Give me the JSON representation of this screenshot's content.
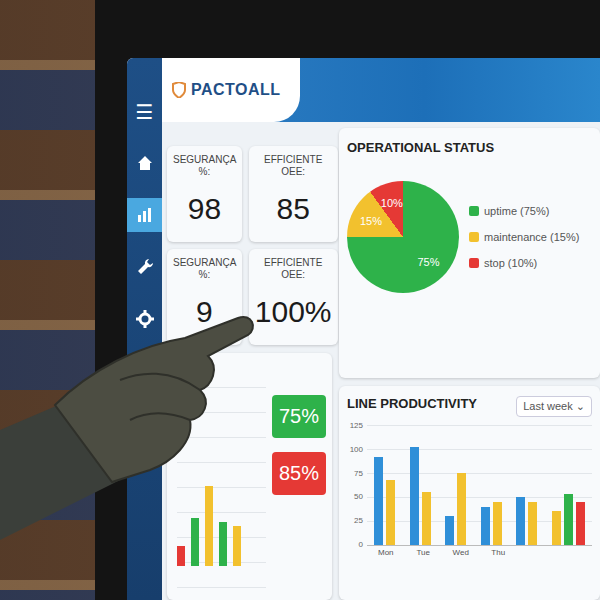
{
  "logo": {
    "text": "PACTOALL"
  },
  "menu_button": "☰",
  "sidebar": {
    "items": [
      {
        "selected": false
      },
      {
        "selected": true
      },
      {
        "selected": false
      },
      {
        "selected": false
      }
    ]
  },
  "kpis": [
    {
      "label": "SEGURANÇA %:",
      "value": "98"
    },
    {
      "label": "EFFICIENTE OEE:",
      "value": "85"
    },
    {
      "label": "SEGURANÇA %:",
      "value": "9"
    },
    {
      "label": "EFFICIENTE OEE:",
      "value": "100%"
    }
  ],
  "mini_chart": {
    "bars": [
      {
        "value": 25,
        "color": "#e53935"
      },
      {
        "value": 60,
        "color": "#2eb24a"
      },
      {
        "value": 100,
        "color": "#f2c12e"
      },
      {
        "value": 55,
        "color": "#2eb24a"
      },
      {
        "value": 50,
        "color": "#f2c12e"
      }
    ],
    "badges": [
      {
        "text": "75%",
        "color": "#2eb24a"
      },
      {
        "text": "85%",
        "color": "#e53935"
      }
    ]
  },
  "status": {
    "title": "OPERATIONAL STATUS",
    "slices": [
      {
        "label": "uptime (75%)",
        "pie_label": "75%",
        "value": 75,
        "color": "#2eb24a"
      },
      {
        "label": "maintenance (15%)",
        "pie_label": "15%",
        "value": 15,
        "color": "#f2c12e"
      },
      {
        "label": "stop (10%)",
        "pie_label": "10%",
        "value": 10,
        "color": "#e53935"
      }
    ]
  },
  "productivity": {
    "title": "LINE PRODUCTIVITY",
    "range": "Last week",
    "range_icon": "⌄",
    "y_ticks": [
      "125",
      "100",
      "75",
      "50",
      "25",
      "0"
    ],
    "y_max": 125,
    "categories": [
      "Mon",
      "Tue",
      "Wed",
      "Thu",
      "",
      ""
    ],
    "series": [
      {
        "color": "#2f8fd8",
        "values": [
          92,
          102,
          30,
          40,
          50,
          0
        ]
      },
      {
        "color": "#f2c12e",
        "values": [
          68,
          55,
          75,
          45,
          45,
          35
        ]
      },
      {
        "color": "#2eb24a",
        "values": [
          0,
          0,
          0,
          0,
          0,
          53
        ]
      },
      {
        "color": "#e53935",
        "values": [
          0,
          0,
          0,
          0,
          0,
          45
        ]
      }
    ]
  }
}
